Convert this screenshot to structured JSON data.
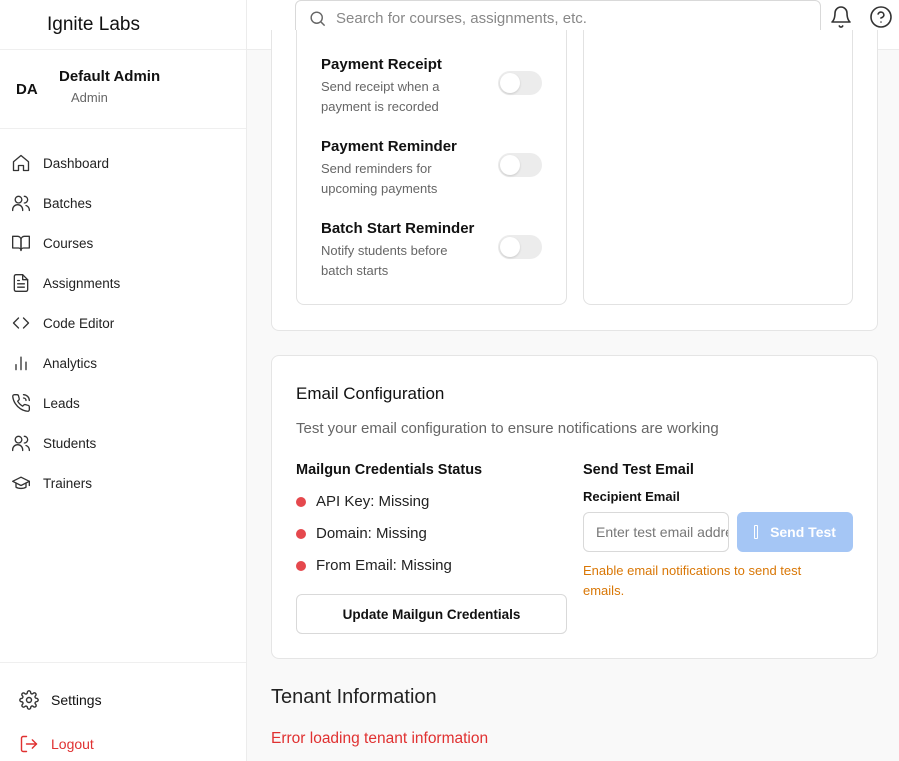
{
  "app": {
    "brand": "Ignite Labs"
  },
  "user": {
    "initials": "DA",
    "name": "Default Admin",
    "role": "Admin"
  },
  "sidebar": {
    "items": [
      {
        "label": "Dashboard",
        "icon": "home-icon"
      },
      {
        "label": "Batches",
        "icon": "users-icon"
      },
      {
        "label": "Courses",
        "icon": "book-open-icon"
      },
      {
        "label": "Assignments",
        "icon": "file-text-icon"
      },
      {
        "label": "Code Editor",
        "icon": "code-icon"
      },
      {
        "label": "Analytics",
        "icon": "bar-chart-icon"
      },
      {
        "label": "Leads",
        "icon": "phone-icon"
      },
      {
        "label": "Students",
        "icon": "users-icon"
      },
      {
        "label": "Trainers",
        "icon": "graduation-cap-icon"
      }
    ],
    "settings_label": "Settings",
    "logout_label": "Logout"
  },
  "search": {
    "placeholder": "Search for courses, assignments, etc."
  },
  "notifications": [
    {
      "title": "Payment Receipt",
      "description": "Send receipt when a payment is recorded",
      "enabled": false
    },
    {
      "title": "Payment Reminder",
      "description": "Send reminders for upcoming payments",
      "enabled": false
    },
    {
      "title": "Batch Start Reminder",
      "description": "Notify students before batch starts",
      "enabled": false
    }
  ],
  "email_config": {
    "title": "Email Configuration",
    "description": "Test your email configuration to ensure notifications are working",
    "credentials_title": "Mailgun Credentials Status",
    "statuses": [
      "API Key: Missing",
      "Domain: Missing",
      "From Email: Missing"
    ],
    "status_color": "#e5484d",
    "update_button": "Update Mailgun Credentials",
    "send_test_title": "Send Test Email",
    "recipient_label": "Recipient Email",
    "recipient_placeholder": "Enter test email address",
    "send_button": "Send Test",
    "warning": "Enable email notifications to send test emails."
  },
  "tenant": {
    "title": "Tenant Information",
    "error": "Error loading tenant information"
  }
}
